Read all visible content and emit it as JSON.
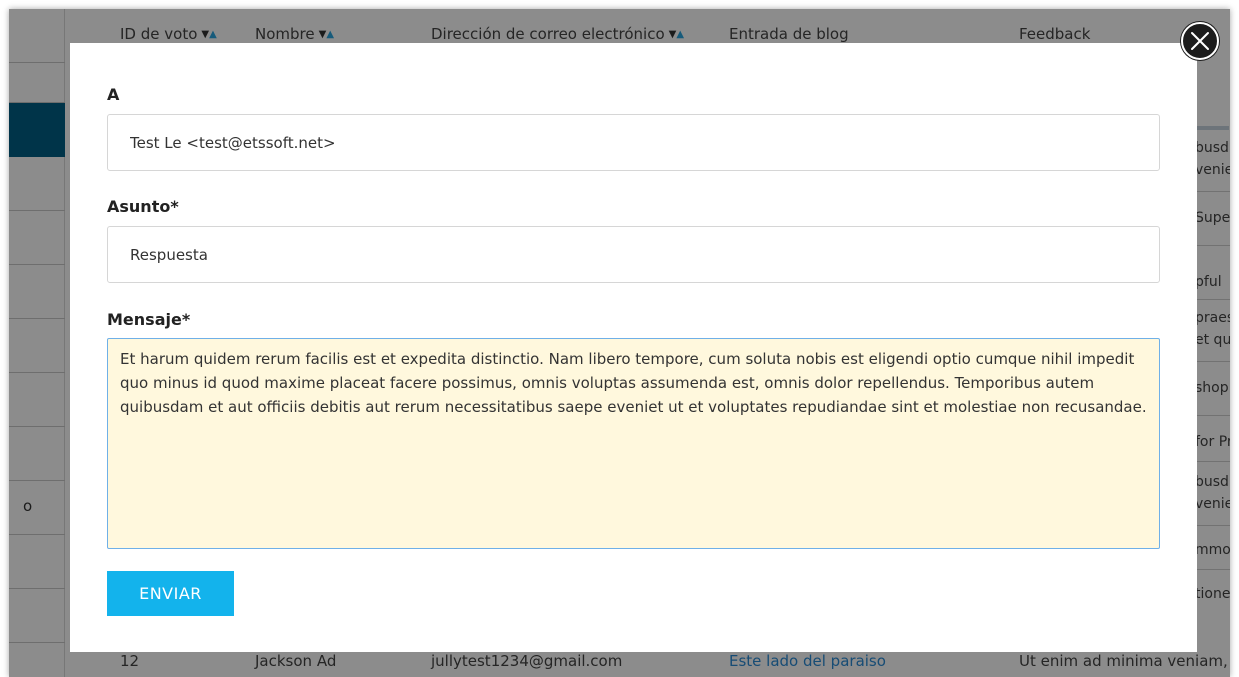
{
  "background": {
    "columns": [
      {
        "label": "ID de voto",
        "sortable": true
      },
      {
        "label": "Nombre",
        "sortable": true
      },
      {
        "label": "Dirección de correo electrónico",
        "sortable": true
      },
      {
        "label": "Entrada de blog",
        "sortable": false
      },
      {
        "label": "Feedback",
        "sortable": false
      }
    ],
    "sidebar_partial_text": "o",
    "right_cell_fragments": [
      "busd",
      "venie",
      "Supe",
      "pful",
      "praes",
      "et qu",
      "shop",
      "for Pr",
      "busd",
      "venie",
      "mmo",
      "tione"
    ],
    "bottom_row": {
      "id": "12",
      "name": "Jackson Ad",
      "email": "jullytest1234@gmail.com",
      "blog_post": "Este lado del paraiso",
      "feedback": "Ut enim ad minima veniam,"
    }
  },
  "modal": {
    "to": {
      "label": "A",
      "value": "Test Le <test@etssoft.net>"
    },
    "subject": {
      "label": "Asunto*",
      "value": "Respuesta"
    },
    "message": {
      "label": "Mensaje*",
      "value": "Et harum quidem rerum facilis est et expedita distinctio. Nam libero tempore, cum soluta nobis est eligendi optio cumque nihil impedit quo minus id quod maxime placeat facere possimus, omnis voluptas assumenda est, omnis dolor repellendus. Temporibus autem quibusdam et aut officiis debitis aut rerum necessitatibus saepe eveniet ut et voluptates repudiandae sint et molestiae non recusandae."
    },
    "send_button_label": "ENVIAR",
    "close_icon": "close-circle-icon"
  },
  "colors": {
    "send_button": "#13b3ec",
    "message_background": "#fff8dd",
    "sidebar_active": "#005f86",
    "link": "#2a8bd6"
  }
}
